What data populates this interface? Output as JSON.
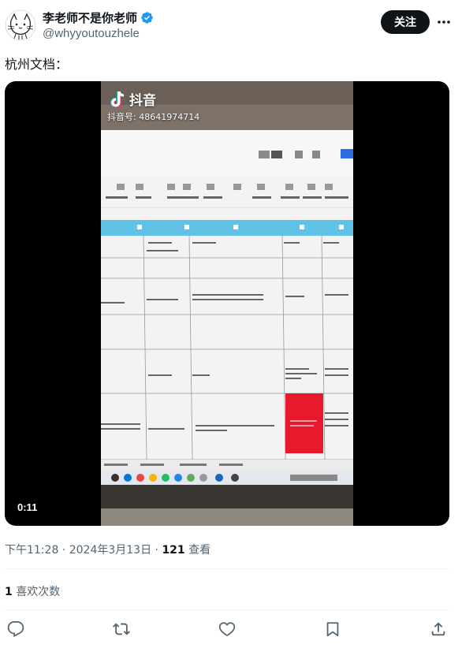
{
  "author": {
    "display_name": "李老师不是你老师",
    "handle": "@whyyoutouzhele",
    "verified": true
  },
  "follow_label": "关注",
  "more_icon": "more-horizontal-icon",
  "tweet_text": "杭州文档：",
  "media": {
    "duration": "0:11",
    "watermark_app": "抖音",
    "watermark_id": "抖音号: 48641974714",
    "screen_tabs": [
      "杭州工厂",
      "杭州事项",
      "杭州项目",
      "杭州自营"
    ]
  },
  "meta": {
    "time": "下午11:28",
    "date": "2024年3月13日",
    "separator": " · ",
    "views_count": "121",
    "views_label": "查看"
  },
  "likes": {
    "count": "1",
    "label": "喜欢次数"
  },
  "actions": [
    "reply-icon",
    "retweet-icon",
    "like-icon",
    "bookmark-icon",
    "share-icon"
  ],
  "colors": {
    "accent_blue": "#1d9bf0",
    "text": "#0f1419",
    "secondary": "#536471",
    "table_header": "#5fc2e6",
    "highlight_red": "#e8192c"
  }
}
